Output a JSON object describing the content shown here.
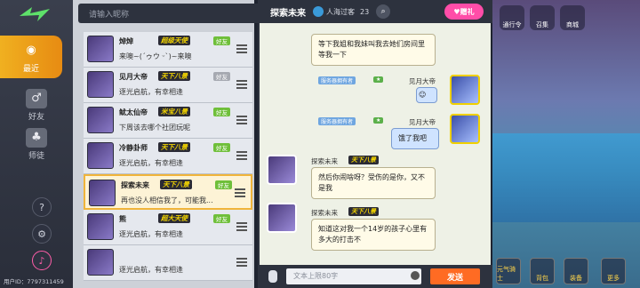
{
  "search": {
    "placeholder": "请输入昵称"
  },
  "rail": {
    "items": [
      {
        "label": "最近",
        "icon": "chat-icon"
      },
      {
        "label": "好友",
        "icon": "friend-icon"
      },
      {
        "label": "师徒",
        "icon": "mentor-icon"
      }
    ],
    "uid": "用户ID：7797311459"
  },
  "friends": [
    {
      "name": "焯焯",
      "title": "超级天使",
      "tag": "好友",
      "message": "来噢~(´ゥウ ᵕ`)~来噢",
      "gray": false
    },
    {
      "name": "见月大帝",
      "title": "天下八景",
      "tag": "好友",
      "message": "逐光启航，有幸相逢",
      "gray": true
    },
    {
      "name": "鱿太仙帝",
      "title": "米宝八景",
      "tag": "好友",
      "message": "下周该去哪个社团玩呢",
      "gray": false
    },
    {
      "name": "冷静卦师",
      "title": "天下八景",
      "tag": "好友",
      "message": "逐光启航，有幸相逢",
      "gray": false
    },
    {
      "name": "探索未来",
      "title": "天下八景",
      "tag": "好友",
      "message": "再也没人相信我了，可能我...",
      "gray": false
    },
    {
      "name": "熊",
      "title": "超大天使",
      "tag": "好友",
      "message": "逐光启航，有幸相逢",
      "gray": false
    },
    {
      "name": "",
      "title": "",
      "tag": "",
      "message": "逐光启航，有幸相逢",
      "gray": false
    }
  ],
  "chat": {
    "name": "探索未来",
    "online": "人海过客",
    "level": "23",
    "gift": "赠礼",
    "messages": [
      {
        "text": "等下我姐和我妹叫我去她们房间里等我一下"
      },
      {
        "sender": "见月大帝",
        "badge": "服务器拥有者",
        "text": ""
      },
      {
        "sender": "见月大帝",
        "badge": "服务器拥有者",
        "text": "饿了我吧"
      },
      {
        "sender": "探索未来",
        "title": "天下八景",
        "text": "然后你闹啥呀？受伤的是你，又不是我"
      },
      {
        "sender": "探索未来",
        "title": "天下八景",
        "text": "知道这对我一个14岁的孩子心里有多大的打击不"
      }
    ],
    "input_placeholder": "文本上限80字",
    "send_label": "发送"
  },
  "game": {
    "top": [
      "通行令",
      "召集",
      "商城"
    ],
    "bottom": [
      "元气骑士",
      "背包",
      "装备",
      "更多"
    ]
  }
}
